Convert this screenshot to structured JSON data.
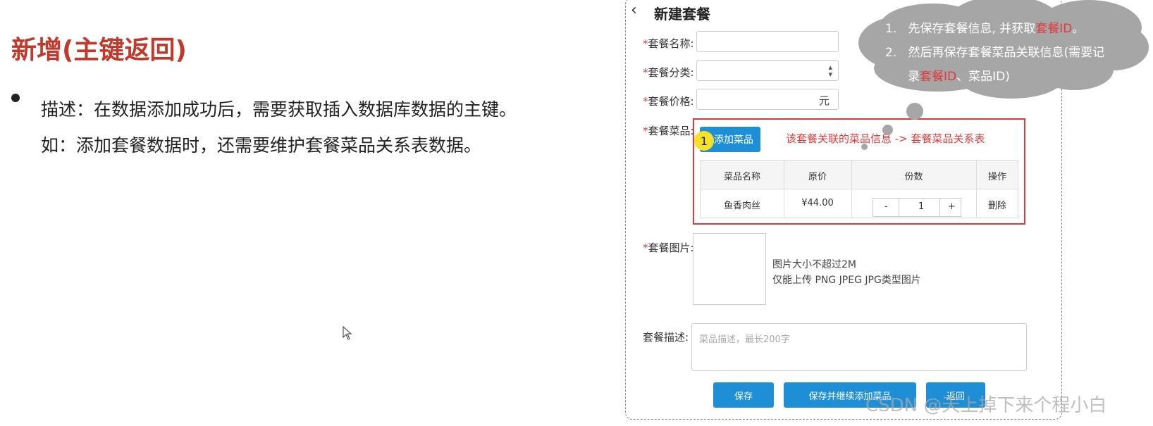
{
  "slide": {
    "title": "新增(主键返回)",
    "desc_line1": "描述：在数据添加成功后，需要获取插入数据库数据的主键。",
    "desc_line2": "如：添加套餐数据时，还需要维护套餐菜品关系表数据。"
  },
  "form": {
    "title": "新建套餐",
    "required_mark": "*",
    "name_label": "套餐名称:",
    "category_label": "套餐分类:",
    "price_label": "套餐价格:",
    "price_unit": "元",
    "dishes_label": "套餐菜品:",
    "add_dish_button": "添加菜品",
    "badge_number": "1",
    "relation_note": "该套餐关联的菜品信息  ->  套餐菜品关系表",
    "table": {
      "headers": [
        "菜品名称",
        "原价",
        "份数",
        "操作"
      ],
      "rows": [
        {
          "name": "鱼香肉丝",
          "price": "¥44.00",
          "qty": "1",
          "action": "删除"
        }
      ]
    },
    "stepper_minus": "-",
    "stepper_plus": "+",
    "image_label": "套餐图片:",
    "image_tip1": "图片大小不超过2M",
    "image_tip2": "仅能上传 PNG JPEG JPG类型图片",
    "desc_label": "套餐描述:",
    "desc_placeholder": "菜品描述，最长200字",
    "buttons": {
      "save": "保存",
      "save_continue": "保存并继续添加菜品",
      "back": "返回"
    }
  },
  "cloud": {
    "item1_num": "1.",
    "item1_pre": "先保存套餐信息, 并获取",
    "item1_hl": "套餐ID",
    "item1_post": "。",
    "item2_num": "2.",
    "item2_line1": "然后再保存套餐菜品关联信息(需要记",
    "item2_line2_pre": "录",
    "item2_line2_hl": "套餐ID",
    "item2_line2_post": "、菜品ID)"
  },
  "watermark": "CSDN @天上掉下来个程小白",
  "colors": {
    "title": "#c0392b",
    "accent_blue": "#1e8fd6",
    "highlight_red": "#e03a3a",
    "cloud_gray": "#a6a6a6",
    "badge_yellow": "#f5e12a"
  }
}
